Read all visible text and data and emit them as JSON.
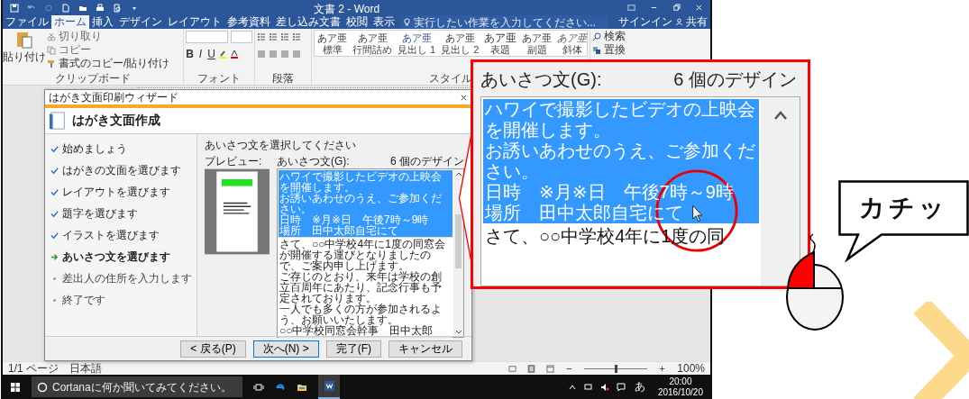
{
  "window": {
    "title": "文書 2 - Word"
  },
  "ribbon_tabs": [
    {
      "label": "ファイル",
      "selected": false
    },
    {
      "label": "ホーム",
      "selected": true
    },
    {
      "label": "挿入",
      "selected": false
    },
    {
      "label": "デザイン",
      "selected": false
    },
    {
      "label": "レイアウト",
      "selected": false
    },
    {
      "label": "参考資料",
      "selected": false
    },
    {
      "label": "差し込み文書",
      "selected": false
    },
    {
      "label": "校閲",
      "selected": false
    },
    {
      "label": "表示",
      "selected": false
    }
  ],
  "tell_me": {
    "placeholder": "実行したい作業を入力してください..."
  },
  "account": {
    "sign_in": "サインイン",
    "share": "共有"
  },
  "clipboard": {
    "paste": "貼り付け",
    "cut": "切り取り",
    "copy": "コピー",
    "format_painter": "書式のコピー/貼り付け",
    "label": "クリップボード"
  },
  "font": {
    "format_buttons": [
      "B",
      "I",
      "U"
    ],
    "label": "フォント"
  },
  "paragraph": {
    "label": "段落"
  },
  "styles": {
    "items": [
      {
        "sample": "あア亜",
        "name": "標準",
        "kind": "body"
      },
      {
        "sample": "あア亜",
        "name": "行間詰め",
        "kind": "body"
      },
      {
        "sample": "あア亜",
        "name": "見出し 1",
        "kind": "heading"
      },
      {
        "sample": "あア亜",
        "name": "見出し 2",
        "kind": "body"
      },
      {
        "sample": "あア亜",
        "name": "表題",
        "kind": "title"
      },
      {
        "sample": "あア亜",
        "name": "副題",
        "kind": "body"
      },
      {
        "sample": "あア亜",
        "name": "斜体",
        "kind": "emphasis"
      }
    ],
    "label": "スタイル"
  },
  "editing": {
    "find": "検索",
    "replace": "置換"
  },
  "dialog": {
    "title": "はがき文面印刷ウィザード",
    "heading": "はがき文面作成",
    "steps": [
      {
        "label": "始めましょう",
        "kind": "done"
      },
      {
        "label": "はがきの文面を選びます",
        "kind": "done"
      },
      {
        "label": "レイアウトを選びます",
        "kind": "done"
      },
      {
        "label": "題字を選びます",
        "kind": "done"
      },
      {
        "label": "イラストを選びます",
        "kind": "done"
      },
      {
        "label": "あいさつ文を選びます",
        "kind": "current"
      },
      {
        "label": "差出人の住所を入力します",
        "kind": "pending"
      },
      {
        "label": "終了です",
        "kind": "pending"
      }
    ],
    "prompt": "あいさつ文を選択してください",
    "preview_label": "プレビュー:",
    "list_label": "あいさつ文(G):",
    "count": "6 個のデザイン",
    "greetings": [
      {
        "lines": [
          "ハワイで撮影したビデオの上映会を開催します。",
          "お誘いあわせのうえ、ご参加ください。",
          "日時　※月※日　午後7時～9時",
          "場所　田中太郎自宅にて"
        ],
        "selected": true
      },
      {
        "lines": [
          "さて、○○中学校4年に1度の同窓会が開催する運びとなりましたので、ご案内申し上げます。",
          "ご存じのとおり、来年は学校の創立百周年にあたり、記念行事も予定されております。",
          "一人でも多くの方が参加されるよう、お願いいたします。",
          "○○中学校同窓会幹事　田中太郎"
        ],
        "selected": false
      }
    ],
    "buttons": [
      {
        "label": "< 戻る(P)",
        "default": false
      },
      {
        "label": "次へ(N) >",
        "default": true
      },
      {
        "label": "完了(F)",
        "default": false
      },
      {
        "label": "キャンセル",
        "default": false
      }
    ]
  },
  "status_bar": {
    "page": "1/1 ページ",
    "language": "日本語",
    "zoom": "100%",
    "zoom_slider": {
      "level": 0.5
    }
  },
  "taskbar": {
    "search": {
      "placeholder": "Cortanaに何か聞いてみてください。"
    },
    "ime": "あ",
    "time": "20:00",
    "date": "2016/10/20"
  },
  "callout": {
    "list_label": "あいさつ文(G):",
    "count": "6 個のデザイン",
    "greetings": [
      {
        "lines": [
          "ハワイで撮影したビデオの上映会を開催します。",
          "お誘いあわせのうえ、ご参加ください。",
          "日時　※月※日　午後7時～9時",
          "場所　田中太郎自宅にて"
        ],
        "selected": true
      },
      {
        "lines": [
          "さて、○○中学校4年に1度の同"
        ],
        "selected": false
      }
    ]
  },
  "speech_bubble": {
    "text": "カチッ"
  }
}
